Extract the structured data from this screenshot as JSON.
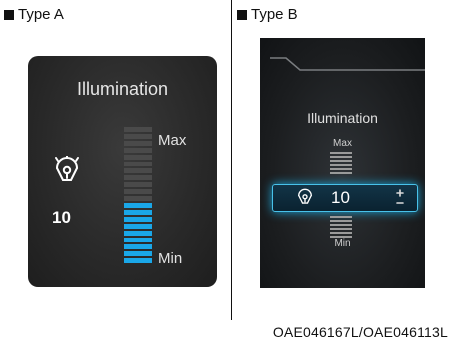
{
  "typeA": {
    "label": "Type A",
    "title": "Illumination",
    "max_label": "Max",
    "min_label": "Min",
    "value": "10",
    "level": 0.45,
    "icon": "dashboard-illumination-icon",
    "colors": {
      "active": "#1aa7e8",
      "inactive": "#4a4a4a",
      "panel": "#2b2b2b"
    }
  },
  "typeB": {
    "label": "Type B",
    "title": "Illumination",
    "max_label": "Max",
    "min_label": "Min",
    "value": "10",
    "icon": "dashboard-illumination-icon",
    "colors": {
      "highlight": "#2cb3e8"
    }
  },
  "caption": "OAE046167L/OAE046113L"
}
